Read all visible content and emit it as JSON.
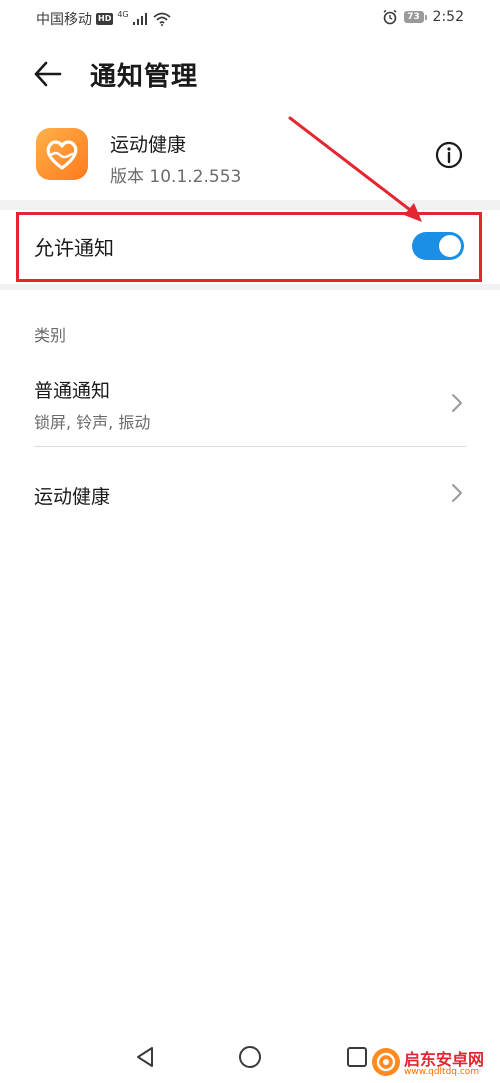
{
  "status_bar": {
    "carrier": "中国移动",
    "hd_badge": "HD",
    "network": "4G",
    "battery_level": "73",
    "time": "2:52",
    "icons": [
      "signal-icon",
      "wifi-icon",
      "alarm-icon",
      "battery-icon"
    ]
  },
  "header": {
    "back_icon": "arrow-left-icon",
    "title": "通知管理"
  },
  "app": {
    "name": "运动健康",
    "version_label": "版本 10.1.2.553",
    "icon": "heart-app-icon",
    "info_icon": "info-icon"
  },
  "allow_notifications": {
    "label": "允许通知",
    "enabled": true
  },
  "category": {
    "label": "类别",
    "items": [
      {
        "title": "普通通知",
        "subtitle": "锁屏, 铃声, 振动"
      },
      {
        "title": "运动健康",
        "subtitle": ""
      }
    ]
  },
  "nav": {
    "icons": [
      "back-triangle-icon",
      "home-circle-icon",
      "recent-square-icon"
    ]
  },
  "watermark": {
    "title": "启东安卓网",
    "url": "www.qdltdq.com"
  },
  "colors": {
    "toggle_on": "#1b8fe6",
    "highlight_red": "#e3262f",
    "app_icon_orange": "#ff8a1f",
    "section_gray": "#f2f2f2"
  }
}
